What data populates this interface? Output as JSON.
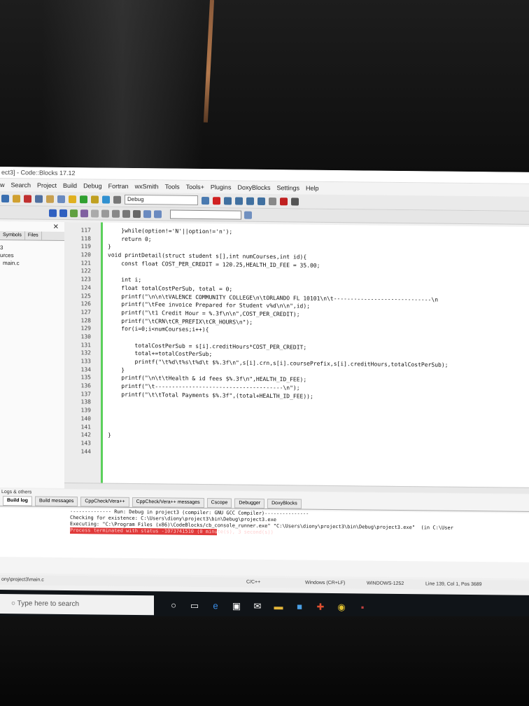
{
  "window": {
    "title": "ect3] - Code::Blocks 17.12"
  },
  "menu": [
    "w",
    "Search",
    "Project",
    "Build",
    "Debug",
    "Fortran",
    "wxSmith",
    "Tools",
    "Tools+",
    "Plugins",
    "DoxyBlocks",
    "Settings",
    "Help"
  ],
  "toolbar": {
    "build_target": "Debug"
  },
  "sidebar": {
    "tabs": [
      "Symbols",
      "Files"
    ],
    "tree": [
      "3",
      "urces",
      "main.c"
    ]
  },
  "editor": {
    "lines": [
      {
        "n": "117",
        "code": "    }while(option!='N'||option!='n');"
      },
      {
        "n": "118",
        "code": "    return 0;"
      },
      {
        "n": "119",
        "code": "}"
      },
      {
        "n": "120",
        "code": "void printDetail(struct student s[],int numCourses,int id){"
      },
      {
        "n": "121",
        "code": "    const float COST_PER_CREDIT = 120.25,HEALTH_ID_FEE = 35.00;"
      },
      {
        "n": "122",
        "code": ""
      },
      {
        "n": "123",
        "code": "    int i;"
      },
      {
        "n": "124",
        "code": "    float totalCostPerSub, total = 0;"
      },
      {
        "n": "125",
        "code": "    printf(\"\\n\\n\\tVALENCE COMMUNITY COLLEGE\\n\\tORLANDO FL 10101\\n\\t-----------------------------\\n"
      },
      {
        "n": "126",
        "code": "    printf(\"\\tFee invoice Prepared for Student v%d\\n\\n\",id);"
      },
      {
        "n": "127",
        "code": "    printf(\"\\t1 Credit Hour = %.3f\\n\\n\",COST_PER_CREDIT);"
      },
      {
        "n": "128",
        "code": "    printf(\"\\tCRN\\tCR_PREFIX\\tCR_HOURS\\n\");"
      },
      {
        "n": "129",
        "code": "    for(i=0;i<numCourses;i++){"
      },
      {
        "n": "130",
        "code": ""
      },
      {
        "n": "131",
        "code": "        totalCostPerSub = s[i].creditHours*COST_PER_CREDIT;"
      },
      {
        "n": "132",
        "code": "        total+=totalCostPerSub;"
      },
      {
        "n": "133",
        "code": "        printf(\"\\t%d\\t%s\\t%d\\t $%.3f\\n\",s[i].crn,s[i].coursePrefix,s[i].creditHours,totalCostPerSub);"
      },
      {
        "n": "134",
        "code": "    }"
      },
      {
        "n": "135",
        "code": "    printf(\"\\n\\t\\tHealth & id fees $%.3f\\n\",HEALTH_ID_FEE);"
      },
      {
        "n": "136",
        "code": "    printf(\"\\t--------------------------------------\\n\");"
      },
      {
        "n": "137",
        "code": "    printf(\"\\t\\tTotal Payments $%.3f\",(total+HEALTH_ID_FEE));"
      },
      {
        "n": "138",
        "code": ""
      },
      {
        "n": "139",
        "code": ""
      },
      {
        "n": "140",
        "code": ""
      },
      {
        "n": "141",
        "code": ""
      },
      {
        "n": "142",
        "code": "}"
      },
      {
        "n": "143",
        "code": ""
      },
      {
        "n": "144",
        "code": ""
      }
    ]
  },
  "logs": {
    "title": "Logs & others",
    "tabs": [
      "Build log",
      "Build messages",
      "CppCheck/Vera++",
      "CppCheck/Vera++ messages",
      "Cscope",
      "Debugger",
      "DoxyBlocks"
    ],
    "lines": [
      "-------------- Run: Debug in project3 (compiler: GNU GCC Compiler)---------------",
      "Checking for existence: C:\\Users\\diony\\project3\\bin\\Debug\\project3.exe",
      "Executing: \"C:\\Program Files (x86)\\CodeBlocks/cb_console_runner.exe\" \"C:\\Users\\diony\\project3\\bin\\Debug\\project3.exe\"  (in C:\\User",
      "Process terminated with status -1073741510 (0 minute(s), 3 second(s))"
    ]
  },
  "status": {
    "file": "ony\\project3\\main.c",
    "language": "C/C++",
    "eol": "Windows (CR+LF)",
    "encoding": "WINDOWS-1252",
    "position": "Line 139, Col 1, Pos 3689"
  },
  "taskbar": {
    "search_placeholder": "Type here to search"
  },
  "colors": {
    "accent_green": "#5cd05c",
    "error_red": "#e03a3a"
  }
}
